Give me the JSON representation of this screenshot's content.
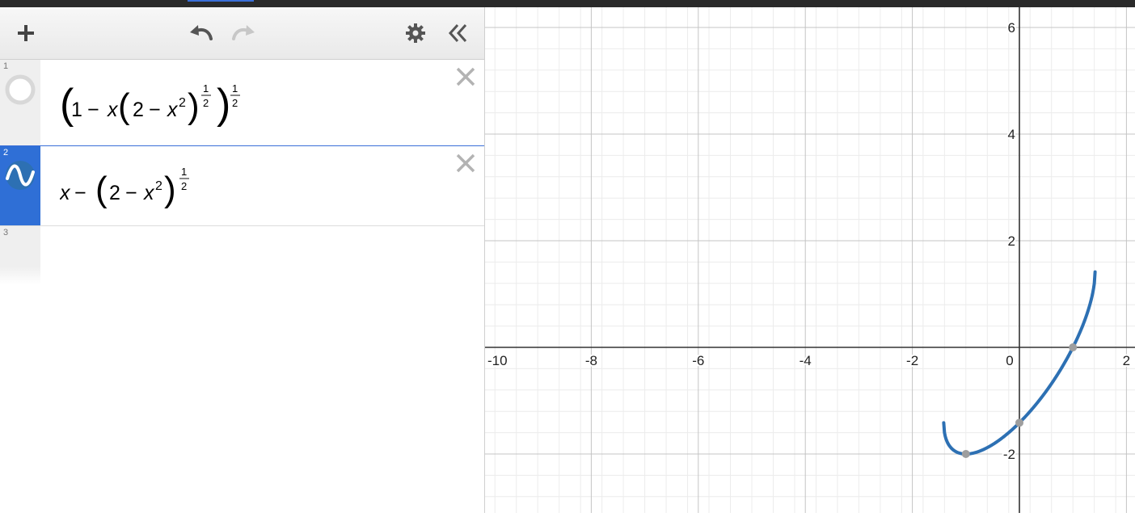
{
  "toolbar": {
    "add_icon": "plus-icon",
    "undo_icon": "undo-icon",
    "redo_icon": "redo-icon",
    "settings_icon": "gear-icon",
    "collapse_icon": "double-chevron-left-icon"
  },
  "expressions": [
    {
      "index": "1",
      "icon": "hidden-circle-icon",
      "latex": "(1 − x(2 − x²)^(1/2))^(1/2)"
    },
    {
      "index": "2",
      "icon": "wave-icon",
      "latex": "x − (2 − x²)^(1/2)",
      "color": "#2d70b3"
    },
    {
      "index": "3"
    }
  ],
  "math": {
    "e1": {
      "one": "1",
      "minus": "−",
      "x": "x",
      "two": "2",
      "x2": "x",
      "sq": "2",
      "num": "1",
      "den": "2"
    },
    "e2": {
      "x": "x",
      "minus": "−",
      "two": "2",
      "x2": "x",
      "sq": "2",
      "num": "1",
      "den": "2"
    }
  },
  "graph": {
    "x_ticks": [
      "-10",
      "-8",
      "-6",
      "-4",
      "-2",
      "0",
      "2"
    ],
    "y_ticks": [
      "6",
      "4",
      "2",
      "-2"
    ],
    "curve_color": "#2d70b3",
    "point_color": "#9e9e9e"
  }
}
